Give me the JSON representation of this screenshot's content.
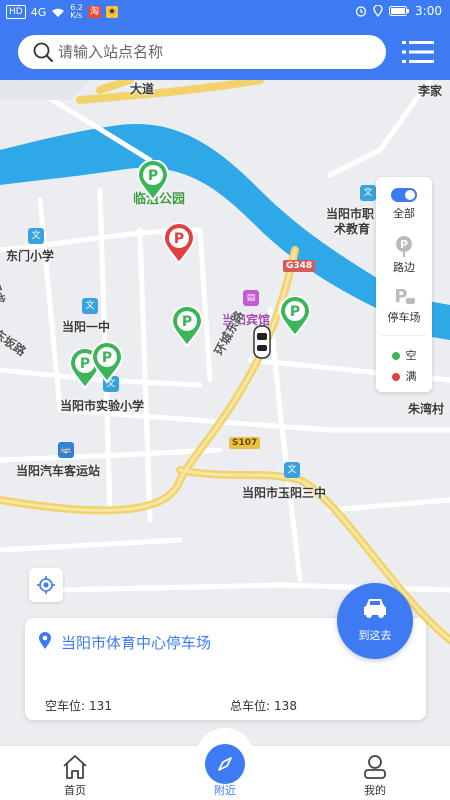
{
  "status_bar": {
    "network": "HD",
    "signal": "4G",
    "speed": "6.2\nK/s",
    "time": "3:00"
  },
  "search": {
    "placeholder": "请输入站点名称"
  },
  "filter": {
    "all_label": "全部",
    "roadside_label": "路边",
    "lot_label": "停车场",
    "empty_label": "空",
    "full_label": "满",
    "colors": {
      "empty": "#3cb55a",
      "full": "#e04040",
      "accent": "#3e7bf3"
    }
  },
  "map": {
    "labels": {
      "park": "临沮公园",
      "school_dongmen": "东门小学",
      "school_yizhong": "当阳一中",
      "school_shiyan": "当阳市实验小学",
      "bus_station": "当阳汽车客运站",
      "school_yuyang": "当阳市玉阳三中",
      "hotel": "当阳宾馆",
      "vocational_1": "当阳市职",
      "vocational_2": "术教育",
      "road_huancheng": "环城东路",
      "road_dongban": "东坂路",
      "road_zi": "子龙",
      "village": "朱湾村",
      "top_right": "李家",
      "top_road": "大道"
    },
    "road_badges": {
      "g348": "G348",
      "s107": "S107"
    }
  },
  "card": {
    "station_name": "当阳市体育中心停车场",
    "empty_label": "空车位:",
    "empty_value": "131",
    "total_label": "总车位:",
    "total_value": "138"
  },
  "navigate_button": {
    "label": "到这去"
  },
  "tabs": [
    {
      "label": "首页",
      "icon": "home-icon"
    },
    {
      "label": "附近",
      "icon": "compass-icon"
    },
    {
      "label": "我的",
      "icon": "user-icon"
    }
  ]
}
